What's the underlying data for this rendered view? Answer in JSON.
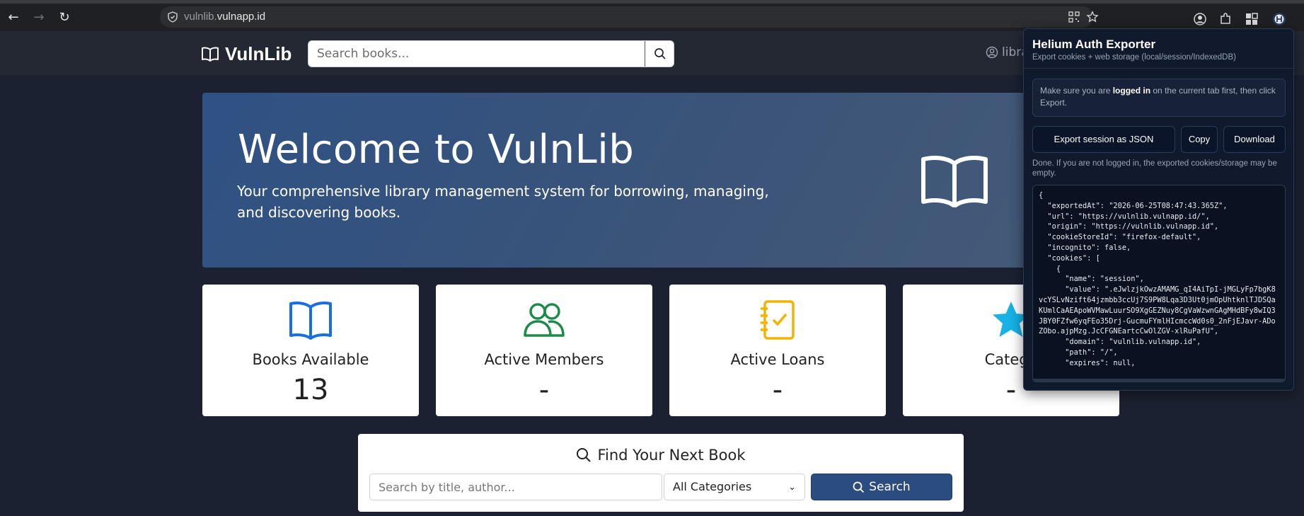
{
  "browser": {
    "url_host_dim": "vulnlib.",
    "url_host_bright": "vulnapp.id"
  },
  "navbar": {
    "brand": "VulnLib",
    "search_placeholder": "Search books...",
    "user_label": "libra"
  },
  "hero": {
    "title": "Welcome to VulnLib",
    "subtitle": "Your comprehensive library management system for borrowing, managing, and discovering books."
  },
  "stats": [
    {
      "label": "Books Available",
      "value": "13",
      "icon": "book-icon",
      "color": "#1a6fe0"
    },
    {
      "label": "Active Members",
      "value": "-",
      "icon": "users-icon",
      "color": "#1e8a4c"
    },
    {
      "label": "Active Loans",
      "value": "-",
      "icon": "journal-check-icon",
      "color": "#f2b400"
    },
    {
      "label": "Catego",
      "value": "-",
      "icon": "star-icon",
      "color": "#17b2e6"
    }
  ],
  "finder": {
    "title": "Find Your Next Book",
    "input_placeholder": "Search by title, author...",
    "category_selected": "All Categories",
    "search_button": "Search"
  },
  "extension": {
    "title": "Helium Auth Exporter",
    "subtitle": "Export cookies + web storage (local/session/IndexedDB)",
    "notice_pre": "Make sure you are ",
    "notice_bold": "logged in",
    "notice_post": " on the current tab first, then click Export.",
    "export_button": "Export session as JSON",
    "copy_button": "Copy",
    "download_button": "Download",
    "status": "Done. If you are not logged in, the exported cookies/storage may be empty.",
    "json_output": "{\n  \"exportedAt\": \"2026-06-25T08:47:43.365Z\",\n  \"url\": \"https://vulnlib.vulnapp.id/\",\n  \"origin\": \"https://vulnlib.vulnapp.id\",\n  \"cookieStoreId\": \"firefox-default\",\n  \"incognito\": false,\n  \"cookies\": [\n    {\n      \"name\": \"session\",\n      \"value\": \".eJwlzjkOwzAMAMG_qI4AiTpI-jMGLyFp7bgK8vcYSLvNzift64jzmbb3ccUj7S9PW8Lqa3D3Ut0jmOpUhtknlTJDSQaKUmlCaAEApoWVMawLuurSO9XgGEZNuy8CgVaWzwnGAgMHdBFy8wIQ3JBY0FZfw6yqFEo35Drj-GucmuFYmlHIcmccWd0s0_2nFjEJavr-ADoZObo.ajpMzg.JcCFGNEartcCwOlZGV-xlRuPafU\",\n      \"domain\": \"vulnlib.vulnapp.id\",\n      \"path\": \"/\",\n      \"expires\": null,"
  }
}
